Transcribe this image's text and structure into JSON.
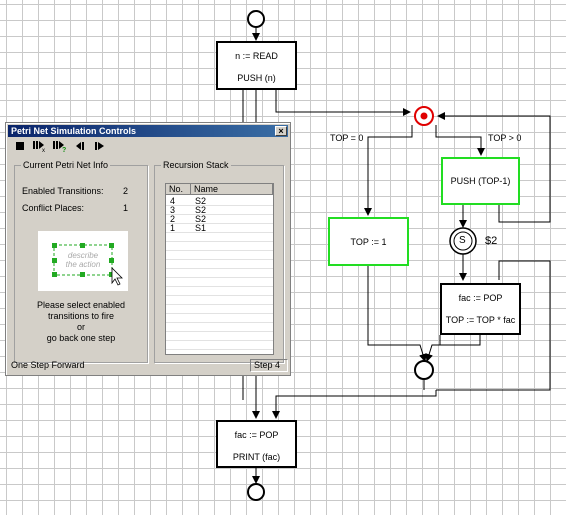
{
  "diagram": {
    "read_box": {
      "line1": "n := READ",
      "line2": "PUSH (n)"
    },
    "guard_zero": "TOP = 0",
    "guard_positive": "TOP > 0",
    "push_box": {
      "label": "PUSH (TOP-1)"
    },
    "assign_box": {
      "label": "TOP := 1"
    },
    "sub_place": {
      "symbol": "S",
      "label": "$2"
    },
    "pop_box": {
      "line1": "fac := POP",
      "line2": "TOP := TOP * fac"
    },
    "print_box": {
      "line1": "fac := POP",
      "line2": "PRINT (fac)"
    },
    "colors": {
      "grid": "#c9c9c9",
      "active_border": "#22dd22",
      "marked_place": "#e00000"
    }
  },
  "dialog": {
    "title": "Petri Net Simulation Controls",
    "toolbar": [
      "stop-icon",
      "step-forward-icon",
      "fire-random-icon",
      "step-back-icon",
      "play-icon"
    ],
    "info_group": {
      "label": "Current Petri Net Info",
      "enabled_label": "Enabled Transitions:",
      "enabled_value": "2",
      "conflict_label": "Conflict Places:",
      "conflict_value": "1",
      "preview_text": "describe the action",
      "message_lines": [
        "Please select enabled",
        "transitions to fire",
        "or",
        "go back one step"
      ]
    },
    "stack_group": {
      "label": "Recursion Stack",
      "columns": [
        "No.",
        "Name"
      ],
      "rows": [
        {
          "no": "4",
          "name": "S2"
        },
        {
          "no": "3",
          "name": "S2"
        },
        {
          "no": "2",
          "name": "S2"
        },
        {
          "no": "1",
          "name": "S1"
        }
      ]
    },
    "status_left": "One Step Forward",
    "status_right": "Step 4"
  }
}
